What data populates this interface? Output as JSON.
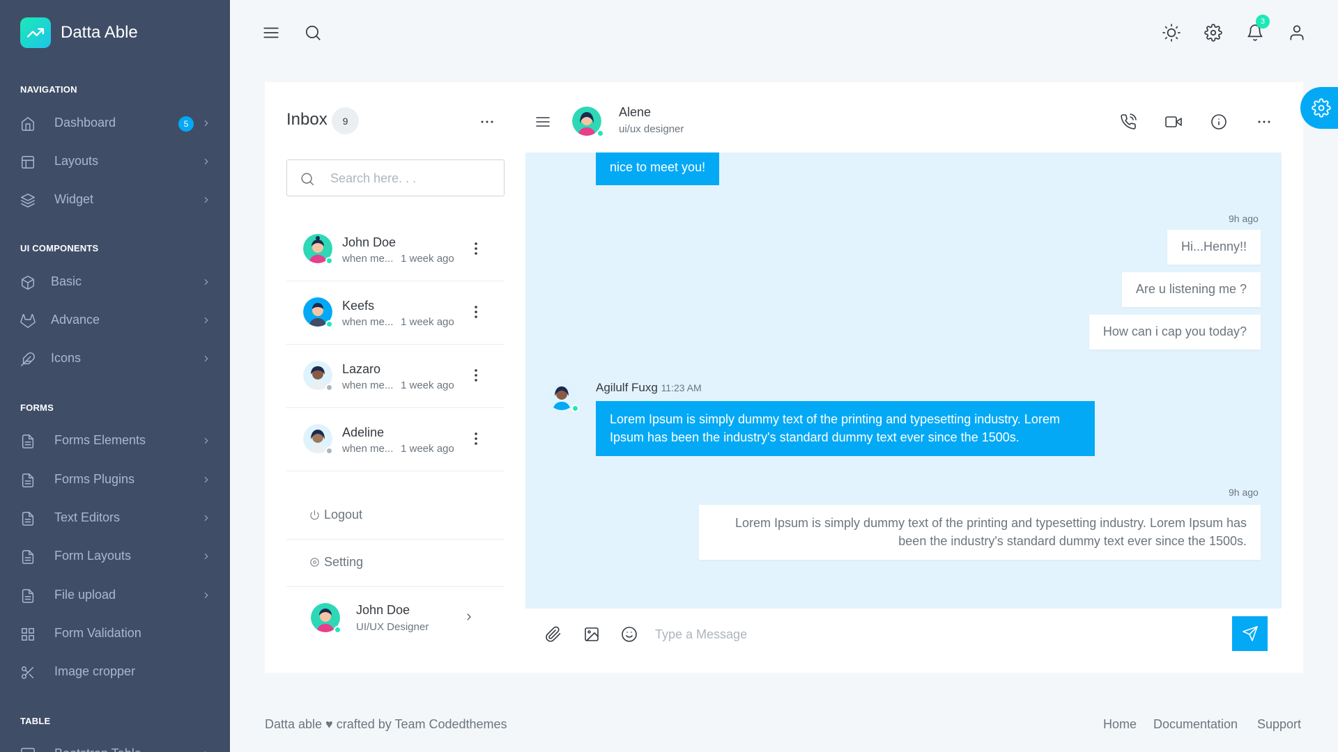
{
  "app": {
    "brand": "Datta Able",
    "accent": "#04a9f5",
    "sidebar_bg": "#3f4d67"
  },
  "sidebar": {
    "sections": [
      {
        "title": "NAVIGATION"
      },
      {
        "title": "UI COMPONENTS"
      },
      {
        "title": "FORMS"
      },
      {
        "title": "TABLE"
      }
    ],
    "items": [
      {
        "label": "Dashboard",
        "badge": "5",
        "icon": "home-icon"
      },
      {
        "label": "Layouts",
        "icon": "layout-icon"
      },
      {
        "label": "Widget",
        "icon": "layers-icon"
      },
      {
        "label": "Basic",
        "icon": "box-icon"
      },
      {
        "label": "Advance",
        "icon": "gitlab-icon"
      },
      {
        "label": "Icons",
        "icon": "feather-icon"
      },
      {
        "label": "Forms Elements",
        "icon": "file-text-icon"
      },
      {
        "label": "Forms Plugins",
        "icon": "file-text-icon"
      },
      {
        "label": "Text Editors",
        "icon": "file-text-icon"
      },
      {
        "label": "Form Layouts",
        "icon": "file-text-icon"
      },
      {
        "label": "File upload",
        "icon": "file-text-icon"
      },
      {
        "label": "Form Validation",
        "icon": "grid-icon"
      },
      {
        "label": "Image cropper",
        "icon": "scissors-icon"
      },
      {
        "label": "Bootstrap Table",
        "icon": "server-icon"
      }
    ]
  },
  "header": {
    "notification_count": "3"
  },
  "inbox": {
    "title": "Inbox",
    "count": "9",
    "search_placeholder": "Search here. . .",
    "contacts": [
      {
        "name": "John Doe",
        "preview": "when me...",
        "time": "1 week ago",
        "status_color": "#1de9b6"
      },
      {
        "name": "Keefs",
        "preview": "when me...",
        "time": "1 week ago",
        "status_color": "#1de9b6"
      },
      {
        "name": "Lazaro",
        "preview": "when me...",
        "time": "1 week ago",
        "status_color": "#adb5bd"
      },
      {
        "name": "Adeline",
        "preview": "when me...",
        "time": "1 week ago",
        "status_color": "#adb5bd"
      }
    ],
    "logout_label": "Logout",
    "setting_label": "Setting",
    "profile": {
      "name": "John Doe",
      "role": "UI/UX Designer"
    }
  },
  "chat": {
    "contact_name": "Alene",
    "contact_role": "ui/ux designer",
    "partial_message": "nice to meet you!",
    "outgoing_1_time": "9h ago",
    "outgoing_1": [
      "Hi...Henny!!",
      "Are u listening me ?",
      "How can i cap you today?"
    ],
    "incoming_sender": "Agilulf Fuxg",
    "incoming_time": "11:23 AM",
    "incoming_text": "Lorem Ipsum is simply dummy text of the printing and typesetting industry. Lorem Ipsum has been the industry's standard dummy text ever since the 1500s.",
    "outgoing_2_time": "9h ago",
    "outgoing_2_text": "Lorem Ipsum is simply dummy text of the printing and typesetting industry. Lorem Ipsum has been the industry's standard dummy text ever since the 1500s.",
    "input_placeholder": "Type a Message"
  },
  "footer": {
    "credit": "Datta able ♥ crafted by Team Codedthemes",
    "links": [
      "Home",
      "Documentation",
      "Support"
    ]
  }
}
